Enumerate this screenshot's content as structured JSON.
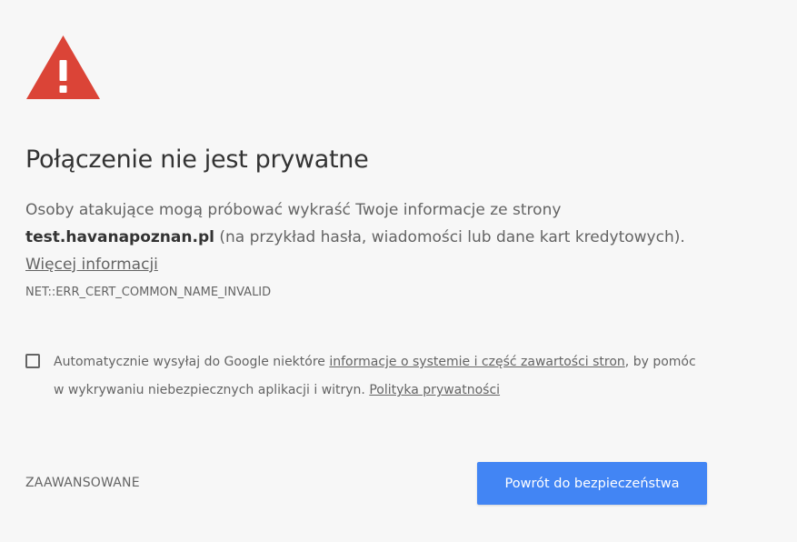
{
  "page": {
    "title": "Połączenie nie jest prywatne",
    "icon": "warning-triangle-icon",
    "colors": {
      "background": "#f7f7f7",
      "warning": "#db4437",
      "primary_button": "#4285f4",
      "heading": "#333333",
      "body_text": "#646464"
    }
  },
  "message": {
    "lead": "Osoby atakujące mogą próbować wykraść Twoje informacje ze strony ",
    "host": "test.havanapoznan.pl",
    "trail": " (na przykład hasła, wiadomości lub dane kart kredytowych). ",
    "learn_more": "Więcej informacji"
  },
  "error_code": "NET::ERR_CERT_COMMON_NAME_INVALID",
  "optin": {
    "checked": false,
    "text_before": "Automatycznie wysyłaj do Google niektóre ",
    "link_system_info": "informacje o systemie i część zawartości stron",
    "text_middle": ", by pomóc w wykrywaniu niebezpiecznych aplikacji i witryn. ",
    "link_privacy": "Polityka prywatności"
  },
  "buttons": {
    "advanced": "ZAAWANSOWANE",
    "back_to_safety": "Powrót do bezpieczeństwa"
  }
}
